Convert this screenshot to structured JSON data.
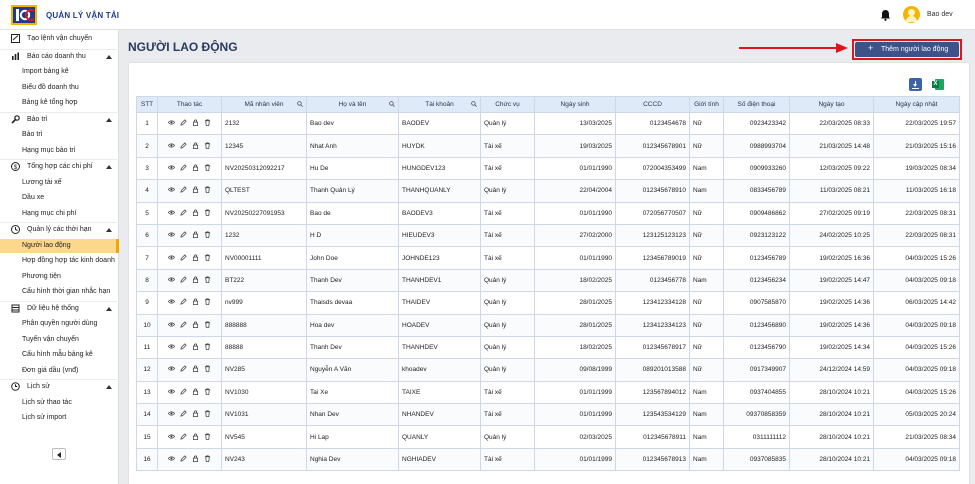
{
  "app": {
    "title": "QUẢN LÝ VẬN TẢI",
    "logo_text": "IOC"
  },
  "user": {
    "name": "Bao dev"
  },
  "sidebar": {
    "items": [
      {
        "type": "section",
        "label": "Tạo lệnh vận chuyển",
        "icon": "ticket-icon",
        "caret": false
      },
      {
        "type": "section",
        "label": "Báo cáo doanh thu",
        "icon": "bar-chart-icon",
        "caret": true
      },
      {
        "type": "sub",
        "label": "Import bảng kê"
      },
      {
        "type": "sub",
        "label": "Biểu đồ doanh thu"
      },
      {
        "type": "sub",
        "label": "Bảng kê tổng hợp"
      },
      {
        "type": "section",
        "label": "Bảo trì",
        "icon": "wrench-icon",
        "caret": true
      },
      {
        "type": "sub",
        "label": "Bảo trì"
      },
      {
        "type": "sub",
        "label": "Hạng mục bảo trì"
      },
      {
        "type": "section",
        "label": "Tổng hợp các chi phí",
        "icon": "money-icon",
        "caret": true
      },
      {
        "type": "sub",
        "label": "Lương tài xế"
      },
      {
        "type": "sub",
        "label": "Dầu xe"
      },
      {
        "type": "sub",
        "label": "Hạng mục chi phí"
      },
      {
        "type": "section",
        "label": "Quản lý các thời hạn",
        "icon": "clock-icon",
        "caret": true
      },
      {
        "type": "sub",
        "label": "Người lao động",
        "active": true
      },
      {
        "type": "sub",
        "label": "Hợp đồng hợp tác kinh doanh"
      },
      {
        "type": "sub",
        "label": "Phương tiện"
      },
      {
        "type": "sub",
        "label": "Cấu hình thời gian nhắc hạn"
      },
      {
        "type": "section",
        "label": "Dữ liệu hệ thống",
        "icon": "database-icon",
        "caret": true
      },
      {
        "type": "sub",
        "label": "Phân quyền người dùng"
      },
      {
        "type": "sub",
        "label": "Tuyến vận chuyển"
      },
      {
        "type": "sub",
        "label": "Cấu hình mẫu bảng kê"
      },
      {
        "type": "sub",
        "label": "Đơn giá dầu (vnđ)"
      },
      {
        "type": "section",
        "label": "Lịch sử",
        "icon": "history-icon",
        "caret": true
      },
      {
        "type": "sub",
        "label": "Lịch sử thao tác"
      },
      {
        "type": "sub",
        "label": "Lịch sử import"
      }
    ]
  },
  "page": {
    "title": "NGƯỜI LAO ĐỘNG",
    "add_button": "Thêm người lao động"
  },
  "table": {
    "columns": [
      {
        "label": "STT",
        "search": false
      },
      {
        "label": "Thao tác",
        "search": false
      },
      {
        "label": "Mã nhân viên",
        "search": true
      },
      {
        "label": "Họ và tên",
        "search": true
      },
      {
        "label": "Tài khoản",
        "search": true
      },
      {
        "label": "Chức vụ",
        "search": false
      },
      {
        "label": "Ngày sinh",
        "search": false
      },
      {
        "label": "CCCD",
        "search": false
      },
      {
        "label": "Giới tính",
        "search": false
      },
      {
        "label": "Số điện thoại",
        "search": false
      },
      {
        "label": "Ngày tạo",
        "search": false
      },
      {
        "label": "Ngày cập nhật",
        "search": false
      }
    ],
    "rows": [
      [
        "1",
        "2132",
        "Bao dev",
        "BAODEV",
        "Quản lý",
        "13/03/2025",
        "0123454678",
        "Nữ",
        "0923423342",
        "22/03/2025 08:33",
        "22/03/2025 19:57"
      ],
      [
        "2",
        "12345",
        "Nhat Anh",
        "HUYDK",
        "Tài xế",
        "19/03/2025",
        "012345678901",
        "Nữ",
        "0988993704",
        "21/03/2025 14:48",
        "21/03/2025 15:16"
      ],
      [
        "3",
        "NV20250312092217",
        "Hu De",
        "HUNGDEV123",
        "Tài xế",
        "01/01/1990",
        "072004353499",
        "Nam",
        "0909933260",
        "12/03/2025 09:22",
        "19/03/2025 08:34"
      ],
      [
        "4",
        "QLTEST",
        "Thanh Quản Lý",
        "THANHQUANLY",
        "Quản lý",
        "22/04/2004",
        "012345678910",
        "Nam",
        "0833456789",
        "11/03/2025 08:21",
        "11/03/2025 16:18"
      ],
      [
        "5",
        "NV20250227091953",
        "Bao de",
        "BAODEV3",
        "Tài xế",
        "01/01/1990",
        "072056770507",
        "Nữ",
        "0909486862",
        "27/02/2025 09:19",
        "22/03/2025 08:31"
      ],
      [
        "6",
        "1232",
        "H D",
        "HIEUDEV3",
        "Tài xế",
        "27/02/2000",
        "123125123123",
        "Nữ",
        "0923123122",
        "24/02/2025 10:25",
        "22/03/2025 08:31"
      ],
      [
        "7",
        "NV00001111",
        "John Doe",
        "JOHNDE123",
        "Tài xế",
        "01/01/1990",
        "123456789019",
        "Nữ",
        "0123456789",
        "19/02/2025 16:36",
        "04/03/2025 15:26"
      ],
      [
        "8",
        "BT222",
        "Thanh Dev",
        "THANHDEV1",
        "Quản lý",
        "18/02/2025",
        "0123456778",
        "Nam",
        "0123456234",
        "19/02/2025 14:47",
        "04/03/2025 09:18"
      ],
      [
        "9",
        "nv999",
        "Thaisds devaa",
        "THAIDEV",
        "Quản lý",
        "28/01/2025",
        "123412334128",
        "Nữ",
        "0907585870",
        "19/02/2025 14:36",
        "06/03/2025 14:42"
      ],
      [
        "10",
        "888888",
        "Hoa dev",
        "HOADEV",
        "Quản lý",
        "28/01/2025",
        "123412334123",
        "Nữ",
        "0123456890",
        "19/02/2025 14:36",
        "04/03/2025 09:18"
      ],
      [
        "11",
        "88888",
        "Thanh Dev",
        "THANHDEV",
        "Quản lý",
        "18/02/2025",
        "012345678917",
        "Nữ",
        "0123456790",
        "19/02/2025 14:34",
        "04/03/2025 15:26"
      ],
      [
        "12",
        "NV285",
        "Nguyễn A Văn",
        "khoadev",
        "Quản lý",
        "09/08/1999",
        "089201013588",
        "Nữ",
        "0917349907",
        "24/12/2024 14:59",
        "04/03/2025 09:18"
      ],
      [
        "13",
        "NV1030",
        "Tai Xe",
        "TAIXE",
        "Tài xế",
        "01/01/1999",
        "123567894012",
        "Nam",
        "0937404855",
        "28/10/2024 10:21",
        "04/03/2025 15:26"
      ],
      [
        "14",
        "NV1031",
        "Nhan Dev",
        "NHANDEV",
        "Tài xế",
        "01/01/1999",
        "123543534129",
        "Nam",
        "09370858359",
        "28/10/2024 10:21",
        "05/03/2025 20:24"
      ],
      [
        "15",
        "NV545",
        "Hi Lap",
        "QUANLY",
        "Quản lý",
        "02/03/2025",
        "012345678911",
        "Nam",
        "0311111112",
        "28/10/2024 10:21",
        "21/03/2025 08:34"
      ],
      [
        "16",
        "NV243",
        "Nghia Dev",
        "NGHIADEV",
        "Tài xế",
        "01/01/1999",
        "012345678913",
        "Nam",
        "0937085835",
        "28/10/2024 10:21",
        "04/03/2025 09:18"
      ]
    ]
  },
  "colors": {
    "accent": "#3c5289",
    "active_bg": "#fcd88d",
    "header_bg": "#dfeaf8",
    "arrow": "#e0141b"
  }
}
